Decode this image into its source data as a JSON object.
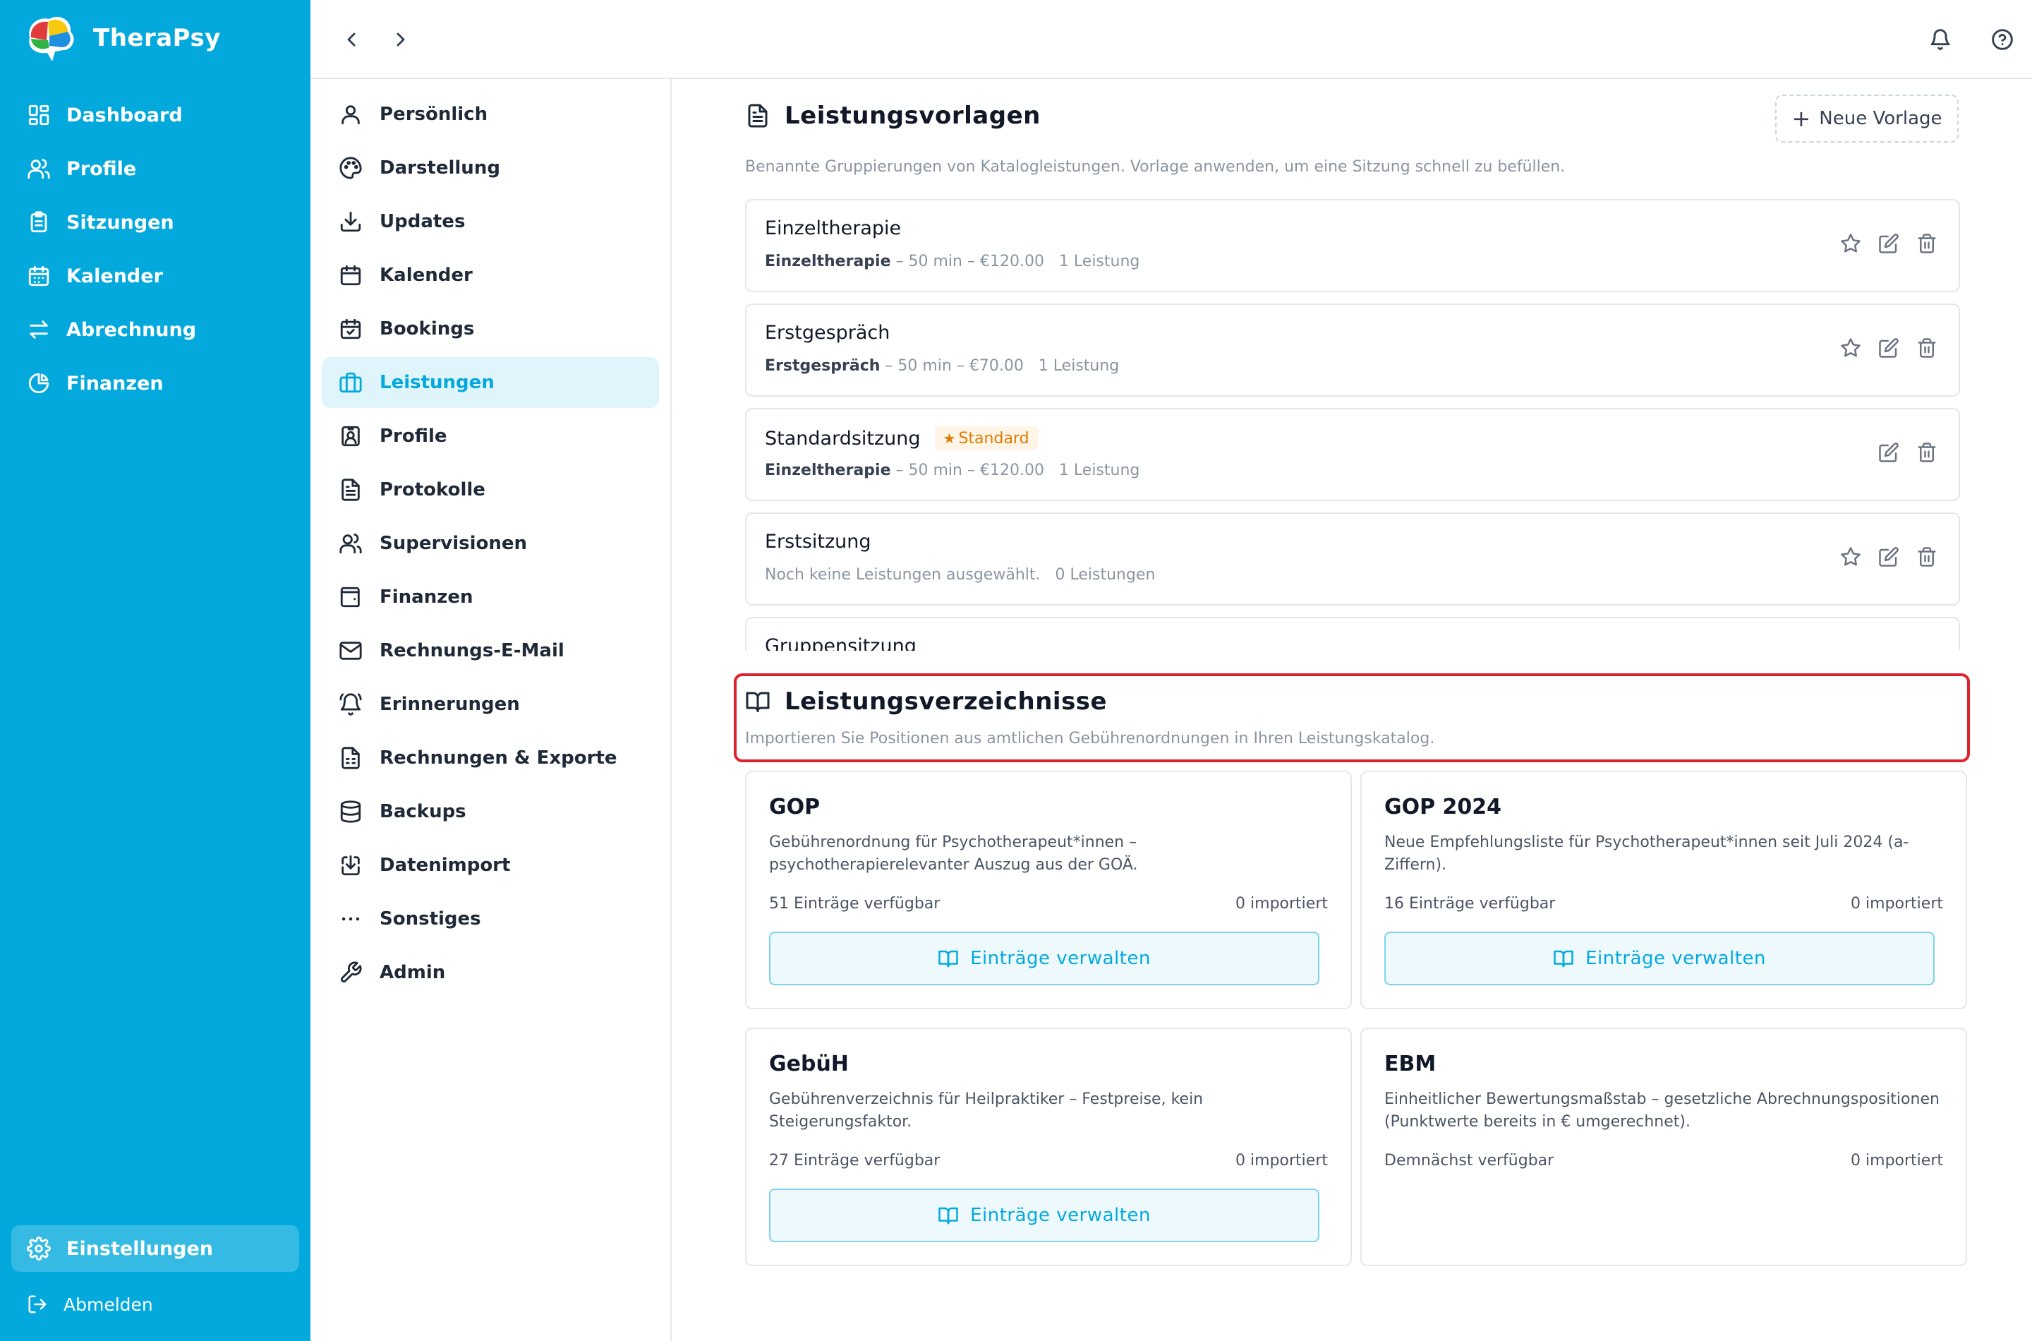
{
  "app": {
    "name": "TheraPsy"
  },
  "sidebar": {
    "items": [
      {
        "label": "Dashboard",
        "icon": "dashboard-icon"
      },
      {
        "label": "Profile",
        "icon": "users-icon"
      },
      {
        "label": "Sitzungen",
        "icon": "clipboard-icon"
      },
      {
        "label": "Kalender",
        "icon": "calendar-icon"
      },
      {
        "label": "Abrechnung",
        "icon": "arrows-icon"
      },
      {
        "label": "Finanzen",
        "icon": "pie-chart-icon"
      }
    ],
    "settings_label": "Einstellungen",
    "logout_label": "Abmelden"
  },
  "subnav": {
    "items": [
      {
        "label": "Persönlich",
        "icon": "user-icon"
      },
      {
        "label": "Darstellung",
        "icon": "palette-icon"
      },
      {
        "label": "Updates",
        "icon": "download-icon"
      },
      {
        "label": "Kalender",
        "icon": "calendar-icon"
      },
      {
        "label": "Bookings",
        "icon": "calendar-check-icon"
      },
      {
        "label": "Leistungen",
        "icon": "briefcase-icon",
        "active": true
      },
      {
        "label": "Profile",
        "icon": "id-badge-icon"
      },
      {
        "label": "Protokolle",
        "icon": "file-text-icon"
      },
      {
        "label": "Supervisionen",
        "icon": "users-icon"
      },
      {
        "label": "Finanzen",
        "icon": "wallet-icon"
      },
      {
        "label": "Rechnungs-E-Mail",
        "icon": "mail-icon"
      },
      {
        "label": "Erinnerungen",
        "icon": "bell-ring-icon"
      },
      {
        "label": "Rechnungen & Exporte",
        "icon": "file-spreadsheet-icon"
      },
      {
        "label": "Backups",
        "icon": "database-icon"
      },
      {
        "label": "Datenimport",
        "icon": "import-icon"
      },
      {
        "label": "Sonstiges",
        "icon": "more-horizontal-icon"
      },
      {
        "label": "Admin",
        "icon": "wrench-icon"
      }
    ]
  },
  "templates": {
    "title": "Leistungsvorlagen",
    "description": "Benannte Gruppierungen von Katalogleistungen. Vorlage anwenden, um eine Sitzung schnell zu befüllen.",
    "new_button": "Neue Vorlage",
    "items": [
      {
        "name": "Einzeltherapie",
        "service": "Einzeltherapie",
        "details": " – 50 min – €120.00   1 Leistung",
        "badge": ""
      },
      {
        "name": "Erstgespräch",
        "service": "Erstgespräch",
        "details": " – 50 min – €70.00   1 Leistung",
        "badge": ""
      },
      {
        "name": "Standardsitzung",
        "service": "Einzeltherapie",
        "details": " – 50 min – €120.00   1 Leistung",
        "badge": "Standard"
      },
      {
        "name": "Erstsitzung",
        "service": "",
        "details": "Noch keine Leistungen ausgewählt.   0 Leistungen",
        "badge": ""
      },
      {
        "name": "Gruppensitzung",
        "service": "",
        "details": "",
        "badge": ""
      }
    ]
  },
  "catalogs": {
    "title": "Leistungsverzeichnisse",
    "description": "Importieren Sie Positionen aus amtlichen Gebührenordnungen in Ihren Leistungskatalog.",
    "manage_label": "Einträge verwalten",
    "items": [
      {
        "title": "GOP",
        "description": "Gebührenordnung für Psychotherapeut*innen – psychotherapierelevanter Auszug aus der GOÄ.",
        "available": "51 Einträge verfügbar",
        "imported": "0 importiert"
      },
      {
        "title": "GOP 2024",
        "description": "Neue Empfehlungsliste für Psychotherapeut*innen seit Juli 2024 (a-Ziffern).",
        "available": "16 Einträge verfügbar",
        "imported": "0 importiert"
      },
      {
        "title": "GebüH",
        "description": "Gebührenverzeichnis für Heilpraktiker – Festpreise, kein Steigerungsfaktor.",
        "available": "27 Einträge verfügbar",
        "imported": "0 importiert"
      },
      {
        "title": "EBM",
        "description": "Einheitlicher Bewertungsmaßstab – gesetzliche Abrechnungspositionen (Punktwerte bereits in € umgerechnet).",
        "available": "Demnächst verfügbar",
        "imported": "0 importiert"
      }
    ]
  },
  "colors": {
    "brand": "#03a9dc",
    "highlight": "#e0212d",
    "badge": "#e07a00"
  }
}
